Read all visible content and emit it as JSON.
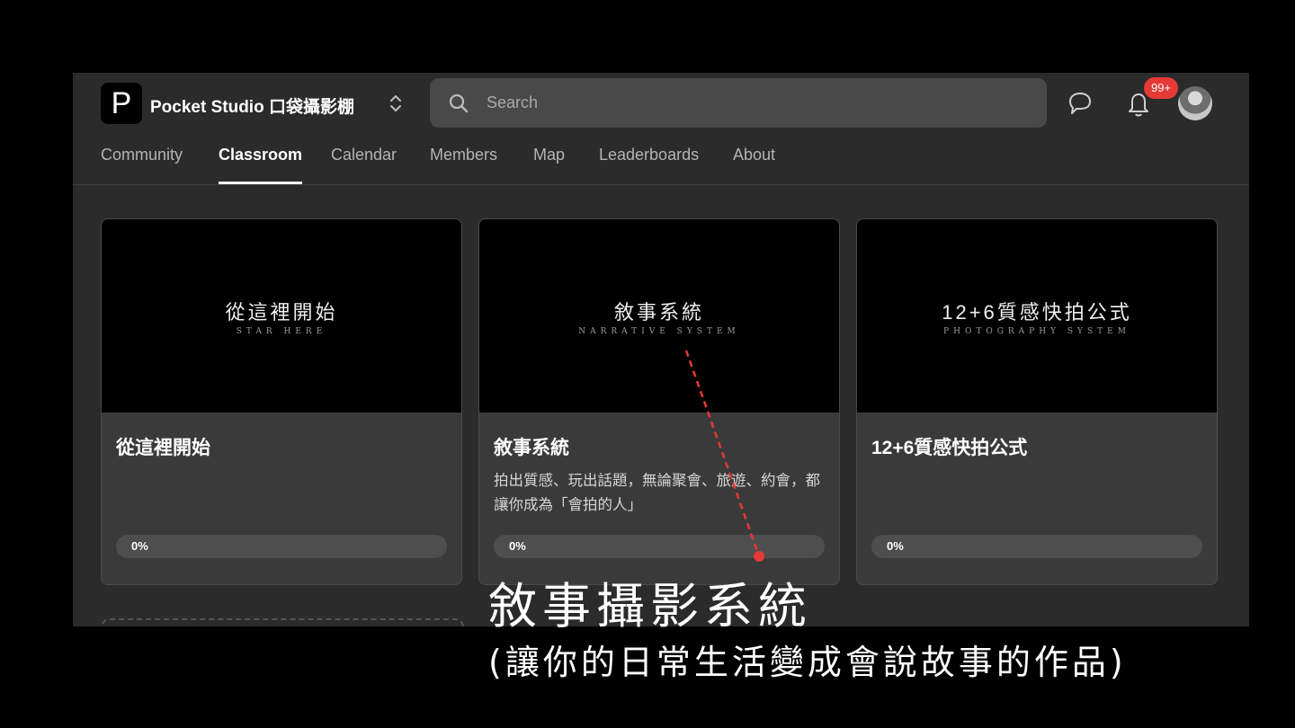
{
  "header": {
    "logo_letter": "P",
    "brand": "Pocket Studio 口袋攝影棚",
    "search_placeholder": "Search",
    "notification_count": "99+"
  },
  "icons": {
    "switcher": "chevron-up-down-icon",
    "search": "search-icon",
    "chat": "chat-bubble-icon",
    "bell": "bell-icon"
  },
  "tabs": [
    {
      "label": "Community",
      "active": false
    },
    {
      "label": "Classroom",
      "active": true
    },
    {
      "label": "Calendar",
      "active": false
    },
    {
      "label": "Members",
      "active": false
    },
    {
      "label": "Map",
      "active": false
    },
    {
      "label": "Leaderboards",
      "active": false
    },
    {
      "label": "About",
      "active": false
    }
  ],
  "courses": [
    {
      "thumb_title": "從這裡開始",
      "thumb_sub": "STAR HERE",
      "title": "從這裡開始",
      "description": "",
      "progress_label": "0%",
      "progress": 0
    },
    {
      "thumb_title": "敘事系統",
      "thumb_sub": "NARRATIVE SYSTEM",
      "title": "敘事系統",
      "description": "拍出質感、玩出話題，無論聚會、旅遊、約會，都讓你成為「會拍的人」",
      "progress_label": "0%",
      "progress": 0
    },
    {
      "thumb_title": "12+6質感快拍公式",
      "thumb_sub": "PHOTOGRAPHY SYSTEM",
      "title": "12+6質感快拍公式",
      "description": "",
      "progress_label": "0%",
      "progress": 0
    }
  ],
  "caption": {
    "main": "敘事攝影系統",
    "sub": "(讓你的日常生活變成會說故事的作品)"
  },
  "colors": {
    "background": "#000000",
    "panel": "#2b2b2b",
    "card": "#3a3a3a",
    "badge": "#e53935",
    "annotation": "#e53935"
  }
}
